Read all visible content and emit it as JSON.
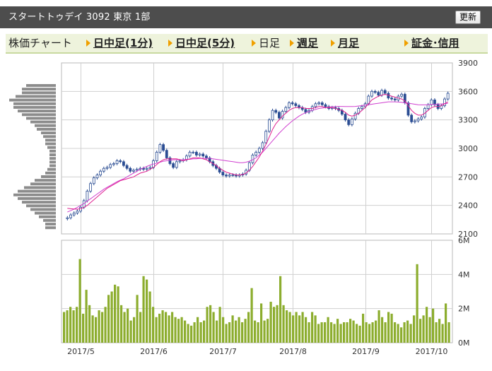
{
  "header": {
    "title": "スタートトゥデイ 3092 東京 1部",
    "refresh_label": "更新"
  },
  "tabs": {
    "label": "株価チャート",
    "items": [
      {
        "label": "日中足(1分)",
        "active": false
      },
      {
        "label": "日中足(5分)",
        "active": false
      },
      {
        "label": "日足",
        "active": true
      },
      {
        "label": "週足",
        "active": false
      },
      {
        "label": "月足",
        "active": false
      },
      {
        "label": "証金･信用",
        "active": false
      }
    ]
  },
  "colors": {
    "candle": "#2b4d93",
    "ma_short": "#e0208f",
    "ma_long": "#d040d0",
    "volume": "#8cad2e",
    "volume_profile": "#8c8c8c",
    "grid": "#d0d0d0"
  },
  "chart_data": [
    {
      "type": "candlestick",
      "ylim": [
        2100,
        3900
      ],
      "yticks": [
        "3900",
        "3600",
        "3300",
        "3000",
        "2700",
        "2400",
        "2100"
      ],
      "xticks": [
        "2017/5",
        "2017/6",
        "2017/7",
        "2017/8",
        "2017/9",
        "2017/10"
      ],
      "close": [
        2270,
        2300,
        2320,
        2340,
        2380,
        2450,
        2550,
        2630,
        2690,
        2720,
        2760,
        2790,
        2800,
        2830,
        2840,
        2870,
        2860,
        2820,
        2790,
        2760,
        2770,
        2780,
        2790,
        2780,
        2790,
        2800,
        2870,
        2960,
        3040,
        2980,
        2900,
        2840,
        2800,
        2860,
        2870,
        2880,
        2920,
        2960,
        2960,
        2930,
        2940,
        2920,
        2900,
        2860,
        2820,
        2790,
        2750,
        2720,
        2710,
        2720,
        2720,
        2710,
        2720,
        2730,
        2770,
        2850,
        2930,
        2960,
        3000,
        3060,
        3180,
        3300,
        3400,
        3380,
        3320,
        3390,
        3430,
        3480,
        3470,
        3450,
        3430,
        3410,
        3380,
        3400,
        3440,
        3470,
        3480,
        3460,
        3440,
        3420,
        3430,
        3420,
        3400,
        3360,
        3300,
        3250,
        3310,
        3370,
        3420,
        3440,
        3470,
        3550,
        3600,
        3590,
        3560,
        3610,
        3580,
        3530,
        3520,
        3510,
        3550,
        3570,
        3480,
        3350,
        3280,
        3290,
        3310,
        3330,
        3420,
        3460,
        3510,
        3460,
        3420,
        3450,
        3520,
        3580
      ],
      "ma_short": [
        2370,
        2365,
        2362,
        2360,
        2365,
        2380,
        2400,
        2430,
        2460,
        2490,
        2520,
        2550,
        2580,
        2600,
        2620,
        2640,
        2660,
        2670,
        2680,
        2690,
        2700,
        2720,
        2740,
        2750,
        2760,
        2780,
        2800,
        2830,
        2860,
        2880,
        2890,
        2890,
        2890,
        2890,
        2880,
        2870,
        2880,
        2890,
        2900,
        2900,
        2900,
        2890,
        2880,
        2860,
        2840,
        2820,
        2790,
        2770,
        2750,
        2740,
        2730,
        2720,
        2720,
        2725,
        2740,
        2770,
        2810,
        2860,
        2910,
        2970,
        3040,
        3120,
        3200,
        3260,
        3300,
        3340,
        3370,
        3400,
        3420,
        3430,
        3430,
        3430,
        3420,
        3420,
        3420,
        3430,
        3440,
        3440,
        3430,
        3430,
        3430,
        3420,
        3410,
        3400,
        3380,
        3350,
        3340,
        3350,
        3370,
        3400,
        3430,
        3470,
        3510,
        3530,
        3550,
        3560,
        3570,
        3560,
        3550,
        3540,
        3530,
        3520,
        3500,
        3450,
        3400,
        3370,
        3350,
        3350,
        3370,
        3400,
        3430,
        3440,
        3440,
        3450,
        3470,
        3490
      ],
      "ma_long": [
        2330,
        2345,
        2360,
        2380,
        2400,
        2420,
        2445,
        2470,
        2495,
        2520,
        2545,
        2570,
        2590,
        2610,
        2630,
        2650,
        2665,
        2680,
        2700,
        2720,
        2740,
        2760,
        2780,
        2795,
        2810,
        2825,
        2835,
        2845,
        2855,
        2865,
        2870,
        2875,
        2880,
        2880,
        2880,
        2880,
        2885,
        2885,
        2890,
        2890,
        2895,
        2895,
        2895,
        2895,
        2890,
        2885,
        2880,
        2875,
        2870,
        2865,
        2860,
        2855,
        2850,
        2850,
        2855,
        2865,
        2880,
        2900,
        2930,
        2960,
        3000,
        3040,
        3080,
        3120,
        3160,
        3195,
        3230,
        3260,
        3290,
        3315,
        3340,
        3360,
        3375,
        3390,
        3400,
        3410,
        3420,
        3425,
        3430,
        3435,
        3438,
        3440,
        3442,
        3442,
        3440,
        3440,
        3440,
        3442,
        3446,
        3450,
        3455,
        3460,
        3465,
        3470,
        3475,
        3480,
        3485,
        3490,
        3490,
        3490,
        3488,
        3485,
        3480,
        3475,
        3470,
        3465,
        3460,
        3458,
        3458,
        3460,
        3462,
        3464,
        3466,
        3468,
        3470,
        3475
      ],
      "volume_profile": [
        14,
        16,
        16,
        19,
        22,
        20,
        20,
        18,
        16,
        14,
        12,
        10,
        9,
        7,
        6,
        5,
        5,
        4,
        3,
        3,
        3,
        3,
        3,
        4,
        5,
        7,
        10,
        12,
        15,
        18,
        20,
        18,
        16,
        14,
        12,
        10,
        8,
        6,
        5,
        5,
        4
      ]
    },
    {
      "type": "bar",
      "ylabel": "",
      "ylim": [
        0,
        6
      ],
      "yticks": [
        "6M",
        "4M",
        "2M",
        "0M"
      ],
      "xticks": [
        "2017/5",
        "2017/6",
        "2017/7",
        "2017/8",
        "2017/9",
        "2017/10"
      ],
      "values_millions": [
        1.8,
        1.9,
        2.1,
        1.9,
        2.1,
        4.9,
        1.7,
        3.1,
        2.2,
        1.6,
        1.5,
        1.9,
        1.8,
        2.1,
        2.8,
        3.0,
        3.4,
        3.3,
        2.2,
        1.8,
        2.0,
        1.3,
        1.5,
        2.8,
        1.8,
        3.9,
        3.7,
        3.0,
        2.1,
        1.5,
        1.7,
        1.9,
        1.8,
        1.6,
        1.8,
        1.5,
        1.4,
        1.5,
        1.3,
        1.1,
        1.0,
        1.2,
        1.5,
        1.2,
        1.3,
        2.1,
        2.2,
        1.8,
        1.3,
        2.1,
        1.5,
        1.1,
        1.2,
        1.6,
        1.3,
        1.5,
        1.2,
        1.4,
        1.8,
        3.2,
        1.3,
        1.2,
        2.3,
        1.3,
        1.4,
        2.4,
        2.1,
        2.2,
        3.9,
        2.2,
        1.9,
        1.8,
        1.6,
        1.8,
        1.6,
        1.8,
        1.5,
        1.2,
        1.8,
        1.6,
        1.1,
        1.2,
        1.2,
        1.5,
        1.2,
        1.1,
        1.4,
        1.1,
        1.2,
        1.2,
        1.4,
        1.3,
        1.1,
        1.0,
        1.7,
        1.2,
        1.1,
        1.2,
        1.3,
        1.9,
        1.5,
        1.2,
        1.8,
        1.7,
        1.2,
        1.1,
        0.9,
        1.2,
        1.3,
        1.1,
        1.6,
        4.6,
        1.4,
        1.6,
        2.1,
        1.5,
        2.0,
        1.2,
        1.4,
        1.1,
        2.3,
        1.2
      ]
    }
  ]
}
